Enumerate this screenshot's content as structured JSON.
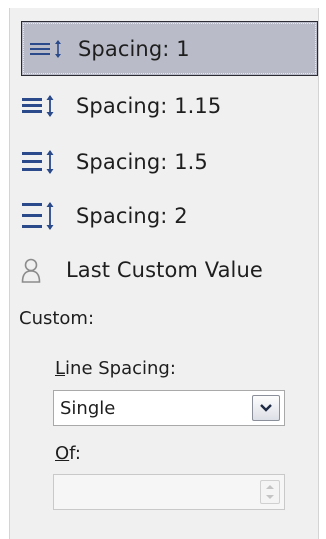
{
  "spacing_menu": {
    "items": [
      {
        "label": "Spacing: 1",
        "icon": "line-spacing-1-icon",
        "selected": true
      },
      {
        "label": "Spacing: 1.15",
        "icon": "line-spacing-115-icon",
        "selected": false
      },
      {
        "label": "Spacing: 1.5",
        "icon": "line-spacing-15-icon",
        "selected": false
      },
      {
        "label": "Spacing: 2",
        "icon": "line-spacing-2-icon",
        "selected": false
      },
      {
        "label": "Last Custom Value",
        "icon": "user-icon",
        "selected": false
      }
    ]
  },
  "custom": {
    "heading": "Custom:",
    "line_spacing": {
      "label_accel": "L",
      "label_rest": "ine Spacing:",
      "value": "Single"
    },
    "of": {
      "label_accel": "O",
      "label_rest": "f:",
      "value": ""
    }
  },
  "colors": {
    "selected_bg": "#b9bcc8",
    "icon_blue": "#2a4a8c",
    "panel_bg": "#f0f0f0"
  }
}
